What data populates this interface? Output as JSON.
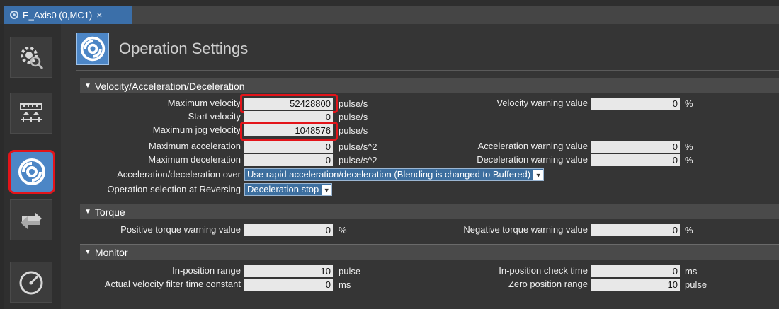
{
  "tab": {
    "title": "E_Axis0 (0,MC1)",
    "close": "×"
  },
  "header": {
    "title": "Operation Settings"
  },
  "sections": {
    "velocity": "Velocity/Acceleration/Deceleration",
    "torque": "Torque",
    "monitor": "Monitor"
  },
  "velocity": {
    "max_velocity": {
      "label": "Maximum velocity",
      "value": "52428800",
      "unit": "pulse/s"
    },
    "start_velocity": {
      "label": "Start velocity",
      "value": "0",
      "unit": "pulse/s"
    },
    "max_jog_velocity": {
      "label": "Maximum jog velocity",
      "value": "1048576",
      "unit": "pulse/s"
    },
    "max_acceleration": {
      "label": "Maximum acceleration",
      "value": "0",
      "unit": "pulse/s^2"
    },
    "max_deceleration": {
      "label": "Maximum deceleration",
      "value": "0",
      "unit": "pulse/s^2"
    },
    "accel_decel_over": {
      "label": "Acceleration/deceleration over",
      "value": "Use rapid acceleration/deceleration (Blending is changed to Buffered)"
    },
    "op_selection_reversing": {
      "label": "Operation selection at Reversing",
      "value": "Deceleration stop"
    },
    "velocity_warning": {
      "label": "Velocity warning value",
      "value": "0",
      "unit": "%"
    },
    "acceleration_warning": {
      "label": "Acceleration warning value",
      "value": "0",
      "unit": "%"
    },
    "deceleration_warning": {
      "label": "Deceleration warning value",
      "value": "0",
      "unit": "%"
    }
  },
  "torque": {
    "positive": {
      "label": "Positive torque warning value",
      "value": "0",
      "unit": "%"
    },
    "negative": {
      "label": "Negative torque warning value",
      "value": "0",
      "unit": "%"
    }
  },
  "monitor": {
    "in_position_range": {
      "label": "In-position range",
      "value": "10",
      "unit": "pulse"
    },
    "velocity_filter": {
      "label": "Actual velocity filter time constant",
      "value": "0",
      "unit": "ms"
    },
    "in_position_check_time": {
      "label": "In-position check time",
      "value": "0",
      "unit": "ms"
    },
    "zero_position_range": {
      "label": "Zero position range",
      "value": "10",
      "unit": "pulse"
    }
  },
  "icons": [
    "axis-settings-gear-icon",
    "unit-conversion-icon",
    "operation-settings-icon",
    "reverse-arrows-icon",
    "gauge-icon"
  ],
  "colors": {
    "accent": "#4c86c6",
    "highlight": "#e3141a",
    "panel": "#353535",
    "field": "#e8e8e8"
  }
}
